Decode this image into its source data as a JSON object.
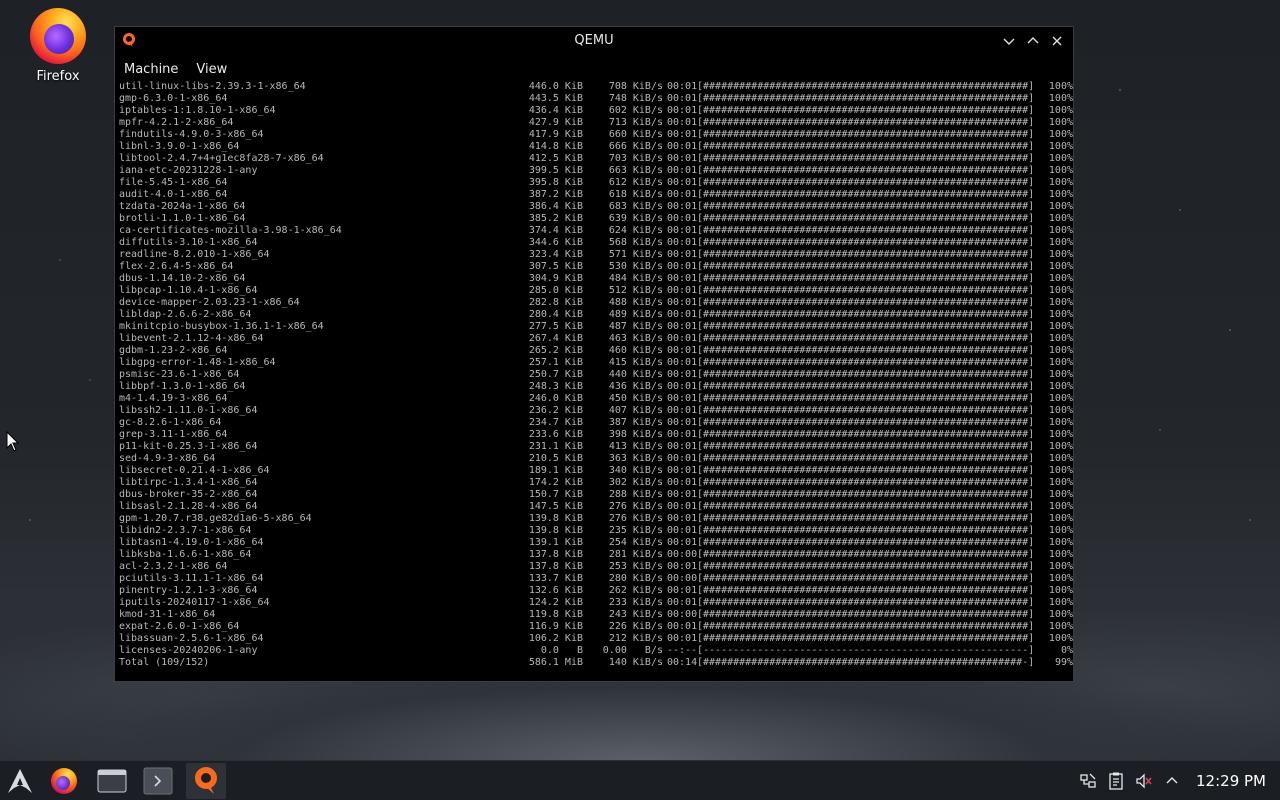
{
  "desktop": {
    "firefox_label": "Firefox"
  },
  "window": {
    "title": "QEMU",
    "menu": [
      "Machine",
      "View"
    ]
  },
  "console": {
    "rows": [
      {
        "name": "util-linux-libs-2.39.3-1-x86_64",
        "size": "446.0 KiB",
        "rate": "708 KiB/s",
        "time": "00:01",
        "bar": "[######################################################]",
        "pct": "100%"
      },
      {
        "name": "gmp-6.3.0-1-x86_64",
        "size": "443.5 KiB",
        "rate": "748 KiB/s",
        "time": "00:01",
        "bar": "[######################################################]",
        "pct": "100%"
      },
      {
        "name": "iptables-1:1.8.10-1-x86_64",
        "size": "436.4 KiB",
        "rate": "602 KiB/s",
        "time": "00:01",
        "bar": "[######################################################]",
        "pct": "100%"
      },
      {
        "name": "mpfr-4.2.1-2-x86_64",
        "size": "427.9 KiB",
        "rate": "713 KiB/s",
        "time": "00:01",
        "bar": "[######################################################]",
        "pct": "100%"
      },
      {
        "name": "findutils-4.9.0-3-x86_64",
        "size": "417.9 KiB",
        "rate": "660 KiB/s",
        "time": "00:01",
        "bar": "[######################################################]",
        "pct": "100%"
      },
      {
        "name": "libnl-3.9.0-1-x86_64",
        "size": "414.8 KiB",
        "rate": "666 KiB/s",
        "time": "00:01",
        "bar": "[######################################################]",
        "pct": "100%"
      },
      {
        "name": "libtool-2.4.7+4+g1ec8fa28-7-x86_64",
        "size": "412.5 KiB",
        "rate": "703 KiB/s",
        "time": "00:01",
        "bar": "[######################################################]",
        "pct": "100%"
      },
      {
        "name": "iana-etc-20231228-1-any",
        "size": "399.5 KiB",
        "rate": "663 KiB/s",
        "time": "00:01",
        "bar": "[######################################################]",
        "pct": "100%"
      },
      {
        "name": "file-5.45-1-x86_64",
        "size": "395.8 KiB",
        "rate": "612 KiB/s",
        "time": "00:01",
        "bar": "[######################################################]",
        "pct": "100%"
      },
      {
        "name": "audit-4.0-1-x86_64",
        "size": "387.2 KiB",
        "rate": "618 KiB/s",
        "time": "00:01",
        "bar": "[######################################################]",
        "pct": "100%"
      },
      {
        "name": "tzdata-2024a-1-x86_64",
        "size": "386.4 KiB",
        "rate": "683 KiB/s",
        "time": "00:01",
        "bar": "[######################################################]",
        "pct": "100%"
      },
      {
        "name": "brotli-1.1.0-1-x86_64",
        "size": "385.2 KiB",
        "rate": "639 KiB/s",
        "time": "00:01",
        "bar": "[######################################################]",
        "pct": "100%"
      },
      {
        "name": "ca-certificates-mozilla-3.98-1-x86_64",
        "size": "374.4 KiB",
        "rate": "624 KiB/s",
        "time": "00:01",
        "bar": "[######################################################]",
        "pct": "100%"
      },
      {
        "name": "diffutils-3.10-1-x86_64",
        "size": "344.6 KiB",
        "rate": "568 KiB/s",
        "time": "00:01",
        "bar": "[######################################################]",
        "pct": "100%"
      },
      {
        "name": "readline-8.2.010-1-x86_64",
        "size": "323.4 KiB",
        "rate": "571 KiB/s",
        "time": "00:01",
        "bar": "[######################################################]",
        "pct": "100%"
      },
      {
        "name": "flex-2.6.4-5-x86_64",
        "size": "307.5 KiB",
        "rate": "530 KiB/s",
        "time": "00:01",
        "bar": "[######################################################]",
        "pct": "100%"
      },
      {
        "name": "dbus-1.14.10-2-x86_64",
        "size": "304.9 KiB",
        "rate": "484 KiB/s",
        "time": "00:01",
        "bar": "[######################################################]",
        "pct": "100%"
      },
      {
        "name": "libpcap-1.10.4-1-x86_64",
        "size": "285.0 KiB",
        "rate": "512 KiB/s",
        "time": "00:01",
        "bar": "[######################################################]",
        "pct": "100%"
      },
      {
        "name": "device-mapper-2.03.23-1-x86_64",
        "size": "282.8 KiB",
        "rate": "488 KiB/s",
        "time": "00:01",
        "bar": "[######################################################]",
        "pct": "100%"
      },
      {
        "name": "libldap-2.6.6-2-x86_64",
        "size": "280.4 KiB",
        "rate": "489 KiB/s",
        "time": "00:01",
        "bar": "[######################################################]",
        "pct": "100%"
      },
      {
        "name": "mkinitcpio-busybox-1.36.1-1-x86_64",
        "size": "277.5 KiB",
        "rate": "487 KiB/s",
        "time": "00:01",
        "bar": "[######################################################]",
        "pct": "100%"
      },
      {
        "name": "libevent-2.1.12-4-x86_64",
        "size": "267.4 KiB",
        "rate": "463 KiB/s",
        "time": "00:01",
        "bar": "[######################################################]",
        "pct": "100%"
      },
      {
        "name": "gdbm-1.23-2-x86_64",
        "size": "265.2 KiB",
        "rate": "460 KiB/s",
        "time": "00:01",
        "bar": "[######################################################]",
        "pct": "100%"
      },
      {
        "name": "libgpg-error-1.48-1-x86_64",
        "size": "257.1 KiB",
        "rate": "415 KiB/s",
        "time": "00:01",
        "bar": "[######################################################]",
        "pct": "100%"
      },
      {
        "name": "psmisc-23.6-1-x86_64",
        "size": "250.7 KiB",
        "rate": "440 KiB/s",
        "time": "00:01",
        "bar": "[######################################################]",
        "pct": "100%"
      },
      {
        "name": "libbpf-1.3.0-1-x86_64",
        "size": "248.3 KiB",
        "rate": "436 KiB/s",
        "time": "00:01",
        "bar": "[######################################################]",
        "pct": "100%"
      },
      {
        "name": "m4-1.4.19-3-x86_64",
        "size": "246.0 KiB",
        "rate": "450 KiB/s",
        "time": "00:01",
        "bar": "[######################################################]",
        "pct": "100%"
      },
      {
        "name": "libssh2-1.11.0-1-x86_64",
        "size": "236.2 KiB",
        "rate": "407 KiB/s",
        "time": "00:01",
        "bar": "[######################################################]",
        "pct": "100%"
      },
      {
        "name": "gc-8.2.6-1-x86_64",
        "size": "234.7 KiB",
        "rate": "387 KiB/s",
        "time": "00:01",
        "bar": "[######################################################]",
        "pct": "100%"
      },
      {
        "name": "grep-3.11-1-x86_64",
        "size": "233.6 KiB",
        "rate": "398 KiB/s",
        "time": "00:01",
        "bar": "[######################################################]",
        "pct": "100%"
      },
      {
        "name": "p11-kit-0.25.3-1-x86_64",
        "size": "231.1 KiB",
        "rate": "413 KiB/s",
        "time": "00:01",
        "bar": "[######################################################]",
        "pct": "100%"
      },
      {
        "name": "sed-4.9-3-x86_64",
        "size": "210.5 KiB",
        "rate": "363 KiB/s",
        "time": "00:01",
        "bar": "[######################################################]",
        "pct": "100%"
      },
      {
        "name": "libsecret-0.21.4-1-x86_64",
        "size": "189.1 KiB",
        "rate": "340 KiB/s",
        "time": "00:01",
        "bar": "[######################################################]",
        "pct": "100%"
      },
      {
        "name": "libtirpc-1.3.4-1-x86_64",
        "size": "174.2 KiB",
        "rate": "302 KiB/s",
        "time": "00:01",
        "bar": "[######################################################]",
        "pct": "100%"
      },
      {
        "name": "dbus-broker-35-2-x86_64",
        "size": "150.7 KiB",
        "rate": "288 KiB/s",
        "time": "00:01",
        "bar": "[######################################################]",
        "pct": "100%"
      },
      {
        "name": "libsasl-2.1.28-4-x86_64",
        "size": "147.5 KiB",
        "rate": "276 KiB/s",
        "time": "00:01",
        "bar": "[######################################################]",
        "pct": "100%"
      },
      {
        "name": "gpm-1.20.7.r38.ge82d1a6-5-x86_64",
        "size": "139.8 KiB",
        "rate": "276 KiB/s",
        "time": "00:01",
        "bar": "[######################################################]",
        "pct": "100%"
      },
      {
        "name": "libidn2-2.3.7-1-x86_64",
        "size": "139.8 KiB",
        "rate": "235 KiB/s",
        "time": "00:01",
        "bar": "[######################################################]",
        "pct": "100%"
      },
      {
        "name": "libtasn1-4.19.0-1-x86_64",
        "size": "139.1 KiB",
        "rate": "254 KiB/s",
        "time": "00:01",
        "bar": "[######################################################]",
        "pct": "100%"
      },
      {
        "name": "libksba-1.6.6-1-x86_64",
        "size": "137.8 KiB",
        "rate": "281 KiB/s",
        "time": "00:00",
        "bar": "[######################################################]",
        "pct": "100%"
      },
      {
        "name": "acl-2.3.2-1-x86_64",
        "size": "137.8 KiB",
        "rate": "253 KiB/s",
        "time": "00:01",
        "bar": "[######################################################]",
        "pct": "100%"
      },
      {
        "name": "pciutils-3.11.1-1-x86_64",
        "size": "133.7 KiB",
        "rate": "280 KiB/s",
        "time": "00:00",
        "bar": "[######################################################]",
        "pct": "100%"
      },
      {
        "name": "pinentry-1.2.1-3-x86_64",
        "size": "132.6 KiB",
        "rate": "262 KiB/s",
        "time": "00:01",
        "bar": "[######################################################]",
        "pct": "100%"
      },
      {
        "name": "iputils-20240117-1-x86_64",
        "size": "124.2 KiB",
        "rate": "233 KiB/s",
        "time": "00:01",
        "bar": "[######################################################]",
        "pct": "100%"
      },
      {
        "name": "kmod-31-1-x86_64",
        "size": "119.8 KiB",
        "rate": "243 KiB/s",
        "time": "00:00",
        "bar": "[######################################################]",
        "pct": "100%"
      },
      {
        "name": "expat-2.6.0-1-x86_64",
        "size": "116.9 KiB",
        "rate": "226 KiB/s",
        "time": "00:01",
        "bar": "[######################################################]",
        "pct": "100%"
      },
      {
        "name": "libassuan-2.5.6-1-x86_64",
        "size": "106.2 KiB",
        "rate": "212 KiB/s",
        "time": "00:01",
        "bar": "[######################################################]",
        "pct": "100%"
      },
      {
        "name": "licenses-20240206-1-any",
        "size": "0.0   B",
        "rate": "0.00   B/s",
        "time": "--:--",
        "bar": "[------------------------------------------------------]",
        "pct": "0%"
      },
      {
        "name": "Total (109/152)",
        "size": "586.1 MiB",
        "rate": "140 KiB/s",
        "time": "00:14",
        "bar": "[#####################################################-]",
        "pct": "99%"
      }
    ]
  },
  "taskbar": {
    "clock": "12:29 PM",
    "items": [
      "app-launcher",
      "firefox",
      "file-manager",
      "terminal",
      "qemu"
    ]
  }
}
